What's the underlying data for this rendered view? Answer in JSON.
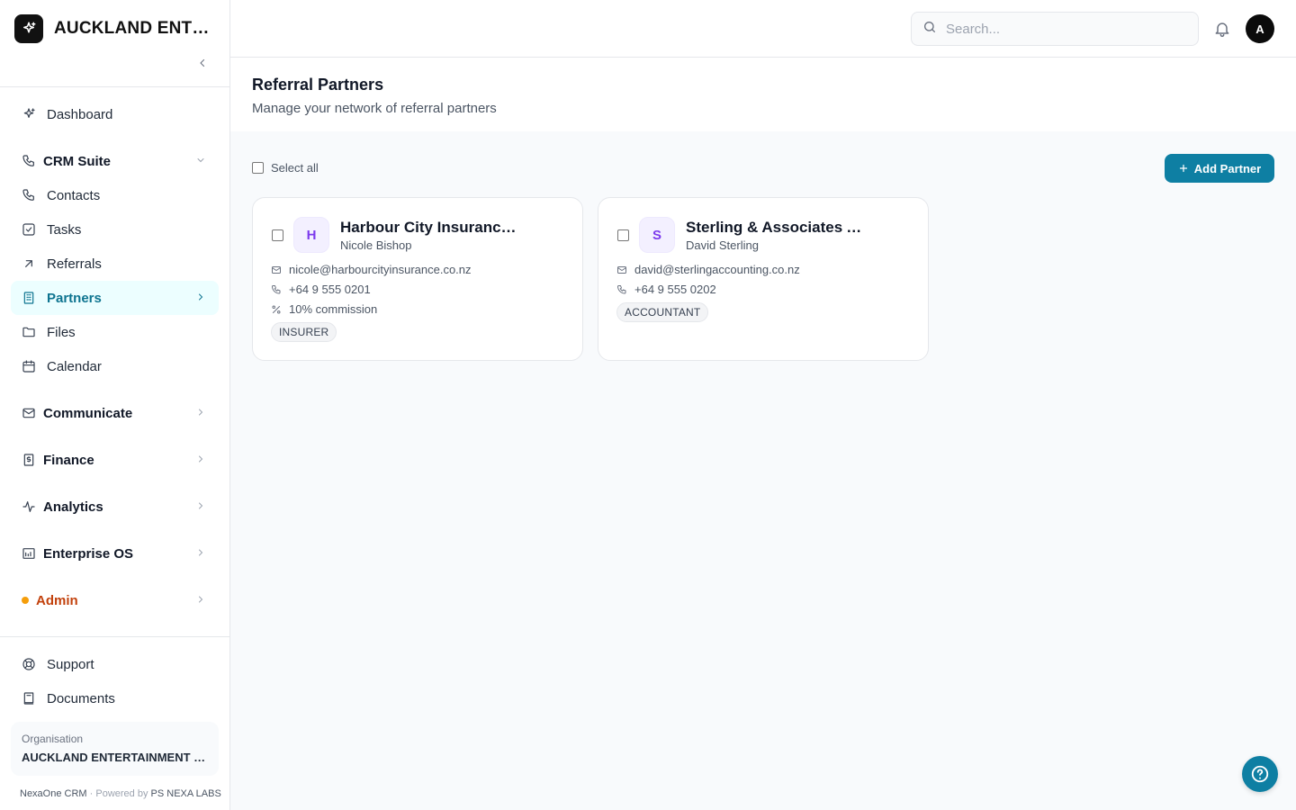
{
  "brand": {
    "name": "AUCKLAND ENTERTAINMENT CO",
    "logo_icon": "sparkles-icon"
  },
  "nav": {
    "dashboard": "Dashboard",
    "crm_suite": "CRM Suite",
    "contacts": "Contacts",
    "tasks": "Tasks",
    "referrals": "Referrals",
    "partners": "Partners",
    "files": "Files",
    "calendar": "Calendar",
    "communicate": "Communicate",
    "finance": "Finance",
    "analytics": "Analytics",
    "enterprise_os": "Enterprise OS",
    "admin": "Admin",
    "support": "Support",
    "documents": "Documents"
  },
  "org": {
    "label": "Organisation",
    "name": "AUCKLAND ENTERTAINMENT COMPANY"
  },
  "footer": {
    "app": "NexaOne CRM",
    "separator": "·",
    "powered": "Powered by",
    "company": "PS NEXA LABS"
  },
  "header": {
    "search_placeholder": "Search...",
    "avatar_initial": "A"
  },
  "page": {
    "title": "Referral Partners",
    "subtitle": "Manage your network of referral partners"
  },
  "toolbar": {
    "select_all": "Select all",
    "add_button": "Add Partner"
  },
  "partners": [
    {
      "initial": "H",
      "name": "Harbour City Insurance Ltd",
      "contact": "Nicole Bishop",
      "email": "nicole@harbourcityinsurance.co.nz",
      "phone": "+64 9 555 0201",
      "commission": "10% commission",
      "type": "INSURER"
    },
    {
      "initial": "S",
      "name": "Sterling & Associates Accounting",
      "contact": "David Sterling",
      "email": "david@sterlingaccounting.co.nz",
      "phone": "+64 9 555 0202",
      "type": "ACCOUNTANT"
    }
  ],
  "colors": {
    "accent": "#0e7fa3",
    "active_bg": "#ecfeff",
    "active_text": "#0e7490",
    "admin": "#c2410c",
    "avatar_tint": "#7c3aed"
  }
}
